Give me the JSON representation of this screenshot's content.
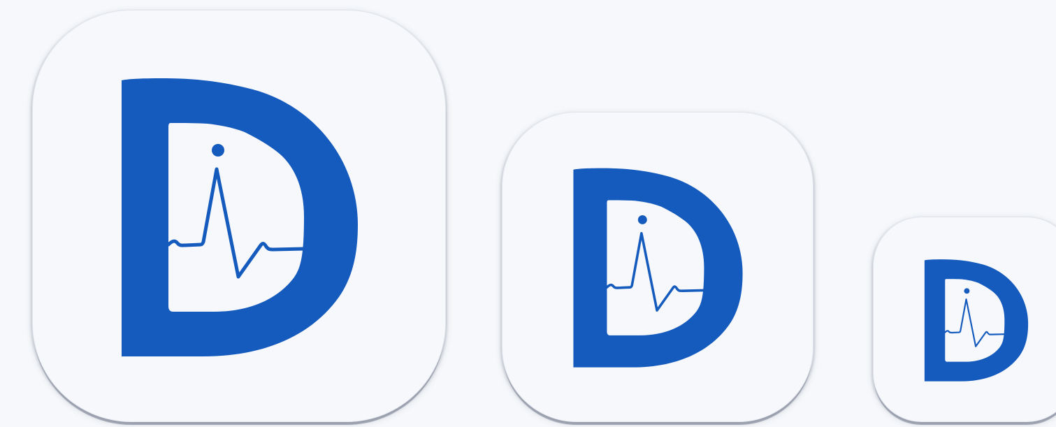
{
  "brand": {
    "primary_color": "#155bbd",
    "background_color": "#f6f8fb",
    "logo": "letter-d-heartbeat-logo"
  },
  "icons": [
    {
      "size": "large",
      "logo": "letter-d-heartbeat-logo"
    },
    {
      "size": "medium",
      "logo": "letter-d-heartbeat-logo"
    },
    {
      "size": "small",
      "logo": "letter-d-heartbeat-logo"
    }
  ]
}
